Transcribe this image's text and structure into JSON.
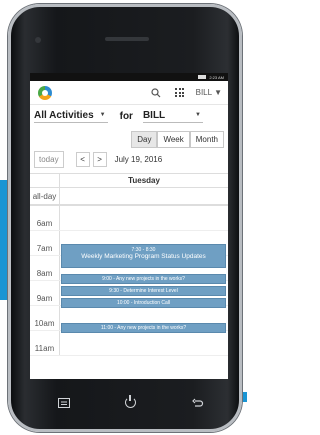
{
  "statusbar": {
    "time": "2:23 AM"
  },
  "appbar": {
    "user": "BILL"
  },
  "filter": {
    "activity": "All Activities",
    "for_label": "for",
    "person": "BILL"
  },
  "views": {
    "day": "Day",
    "week": "Week",
    "month": "Month"
  },
  "nav": {
    "today": "today",
    "prev": "<",
    "next": ">",
    "date": "July 19, 2016"
  },
  "calendar": {
    "day_header": "Tuesday",
    "allday": "all-day",
    "hours": [
      "6am",
      "7am",
      "8am",
      "9am",
      "10am",
      "11am"
    ],
    "events": [
      {
        "time": "7:30 - 8:30",
        "title": "Weekly Marketing Program Status Updates"
      },
      {
        "title": "9:00 - Any new projects in the works?"
      },
      {
        "title": "9:30 - Determine Interest Level"
      },
      {
        "title": "10:00 - Introduction Call"
      },
      {
        "title": "11:00 - Any new projects in the works?"
      }
    ]
  },
  "colors": {
    "accent": "#1a95d4",
    "event": "#6f9fc3"
  }
}
